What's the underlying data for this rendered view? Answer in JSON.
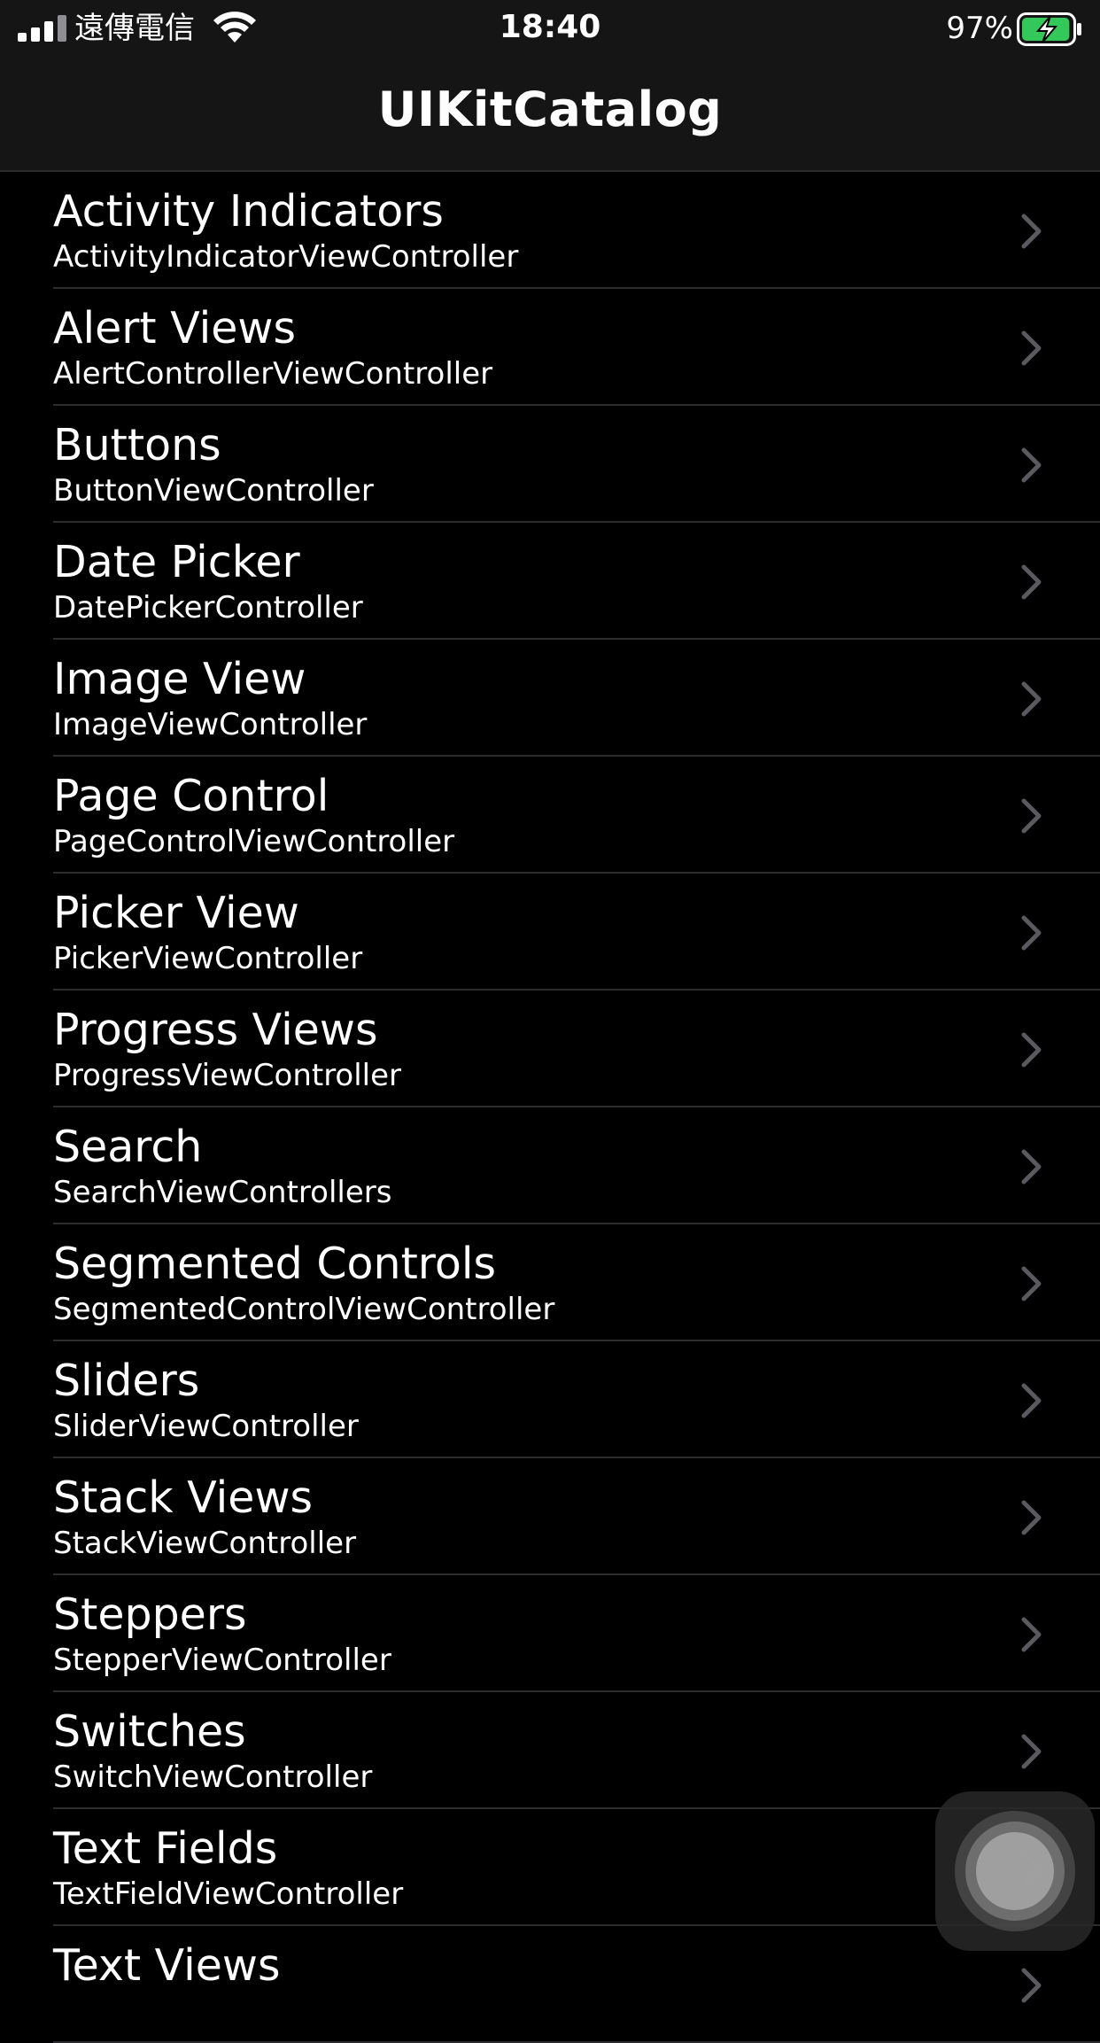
{
  "status_bar": {
    "carrier": "遠傳電信",
    "time": "18:40",
    "battery_percent": "97%",
    "battery_level": 0.97
  },
  "nav": {
    "title": "UIKitCatalog"
  },
  "colors": {
    "background": "#000000",
    "nav_background": "#151515",
    "separator": "#2c2c2e",
    "chevron": "#5a5a5e",
    "battery_green": "#34c759"
  },
  "rows": [
    {
      "title": "Activity Indicators",
      "subtitle": "ActivityIndicatorViewController"
    },
    {
      "title": "Alert Views",
      "subtitle": "AlertControllerViewController"
    },
    {
      "title": "Buttons",
      "subtitle": "ButtonViewController"
    },
    {
      "title": "Date Picker",
      "subtitle": "DatePickerController"
    },
    {
      "title": "Image View",
      "subtitle": "ImageViewController"
    },
    {
      "title": "Page Control",
      "subtitle": "PageControlViewController"
    },
    {
      "title": "Picker View",
      "subtitle": "PickerViewController"
    },
    {
      "title": "Progress Views",
      "subtitle": "ProgressViewController"
    },
    {
      "title": "Search",
      "subtitle": "SearchViewControllers"
    },
    {
      "title": "Segmented Controls",
      "subtitle": "SegmentedControlViewController"
    },
    {
      "title": "Sliders",
      "subtitle": "SliderViewController"
    },
    {
      "title": "Stack Views",
      "subtitle": "StackViewController"
    },
    {
      "title": "Steppers",
      "subtitle": "StepperViewController"
    },
    {
      "title": "Switches",
      "subtitle": "SwitchViewController"
    },
    {
      "title": "Text Fields",
      "subtitle": "TextFieldViewController"
    },
    {
      "title": "Text Views",
      "subtitle": ""
    }
  ]
}
